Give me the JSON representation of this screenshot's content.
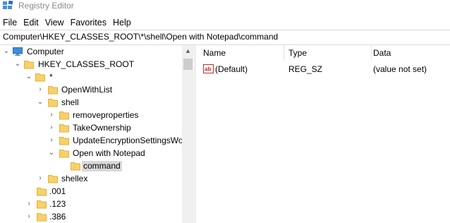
{
  "window": {
    "title": "Registry Editor"
  },
  "menu": [
    "File",
    "Edit",
    "View",
    "Favorites",
    "Help"
  ],
  "address": {
    "path": "Computer\\HKEY_CLASSES_ROOT\\*\\shell\\Open with Notepad\\command"
  },
  "tree": [
    {
      "label": "Computer",
      "expander": "down",
      "icon": "computer-icon"
    },
    {
      "label": "HKEY_CLASSES_ROOT",
      "expander": "down",
      "icon": "folder-icon"
    },
    {
      "label": "*",
      "expander": "down",
      "icon": "folder-icon"
    },
    {
      "label": "OpenWithList",
      "expander": "right",
      "icon": "folder-icon"
    },
    {
      "label": "shell",
      "expander": "down",
      "icon": "folder-icon"
    },
    {
      "label": "removeproperties",
      "expander": "right",
      "icon": "folder-icon"
    },
    {
      "label": "TakeOwnership",
      "expander": "right",
      "icon": "folder-icon"
    },
    {
      "label": "UpdateEncryptionSettingsWo",
      "expander": "right",
      "icon": "folder-icon"
    },
    {
      "label": "Open with Notepad",
      "expander": "down",
      "icon": "folder-icon"
    },
    {
      "label": "command",
      "expander": "none",
      "icon": "folder-icon",
      "selected": true
    },
    {
      "label": "shellex",
      "expander": "right",
      "icon": "folder-icon"
    },
    {
      "label": ".001",
      "expander": "none",
      "icon": "folder-icon"
    },
    {
      "label": ".123",
      "expander": "right",
      "icon": "folder-icon"
    },
    {
      "label": ".386",
      "expander": "right",
      "icon": "folder-icon"
    }
  ],
  "list": {
    "columns": [
      "Name",
      "Type",
      "Data"
    ],
    "rows": [
      {
        "icon": "ab-string-icon",
        "name": "(Default)",
        "type": "REG_SZ",
        "data": "(value not set)"
      }
    ]
  },
  "colors": {
    "folder": "#f6d16b",
    "folder_edge": "#e2b13c",
    "selection": "#d9d9d9",
    "string_icon": "#c62828"
  }
}
